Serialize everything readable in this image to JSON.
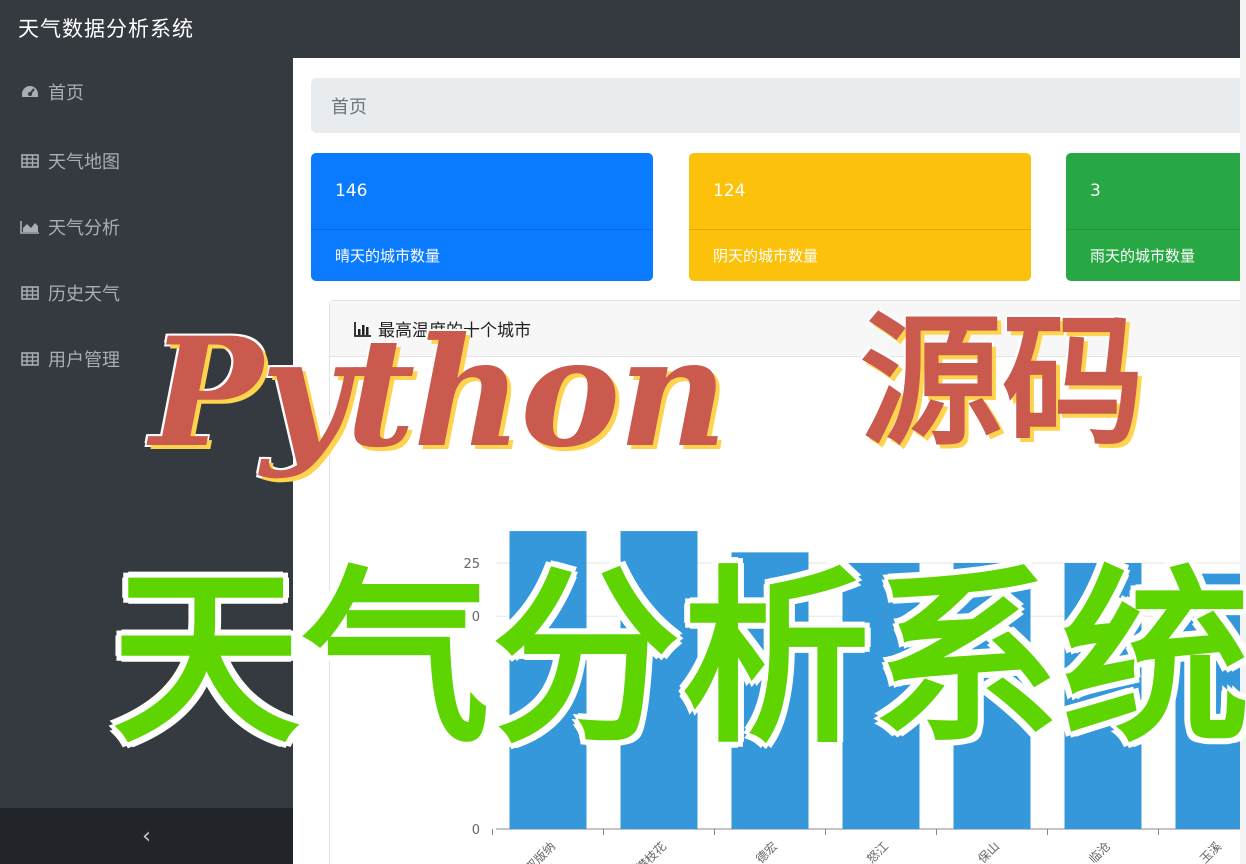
{
  "app": {
    "title": "天气数据分析系统"
  },
  "sidebar": {
    "items": [
      {
        "label": "首页",
        "icon": "dashboard-icon"
      },
      {
        "label": "天气地图",
        "icon": "table-icon"
      },
      {
        "label": "天气分析",
        "icon": "area-chart-icon"
      },
      {
        "label": "历史天气",
        "icon": "table-icon"
      },
      {
        "label": "用户管理",
        "icon": "table-icon"
      }
    ],
    "collapse_label": "‹"
  },
  "breadcrumb": {
    "label": "首页"
  },
  "stats": [
    {
      "value": "146",
      "label": "晴天的城市数量",
      "color": "#0a7bff"
    },
    {
      "value": "124",
      "label": "阴天的城市数量",
      "color": "#fbc10b"
    },
    {
      "value": "3",
      "label": "雨天的城市数量",
      "color": "#27a844"
    }
  ],
  "chart_card": {
    "title": "最高温度的十个城市",
    "icon": "bar-chart-icon"
  },
  "chart_data": {
    "type": "bar",
    "title": "",
    "categories": [
      "西双版纳",
      "攀枝花",
      "德宏",
      "怒江",
      "保山",
      "临沧",
      "玉溪"
    ],
    "values": [
      28,
      28,
      26,
      25,
      25,
      25,
      24
    ],
    "yticks": [
      0,
      20,
      25
    ],
    "ylim": [
      0,
      30
    ],
    "color": "#3498db",
    "grid": true
  },
  "overlay": {
    "line1": "Python",
    "line1b": "源码",
    "line2": "天气分析系统"
  }
}
